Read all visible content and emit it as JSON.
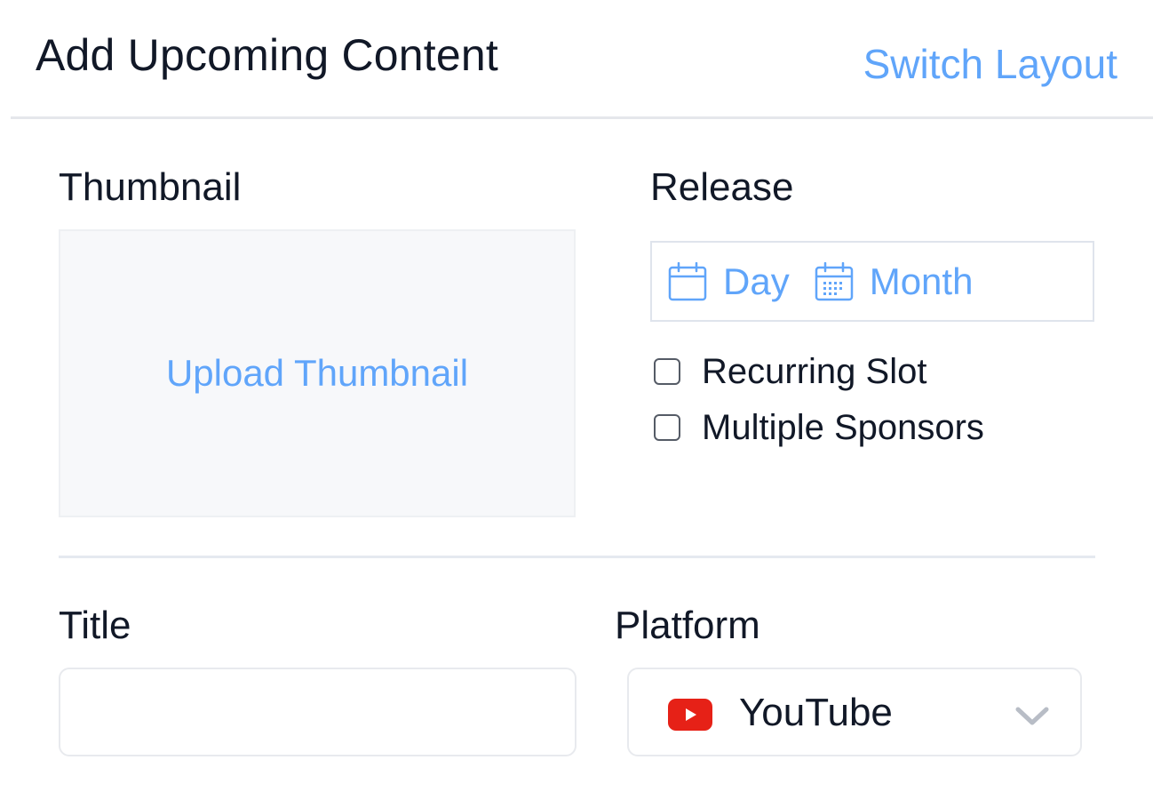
{
  "header": {
    "title": "Add Upcoming Content",
    "switch_layout_label": "Switch Layout"
  },
  "thumbnail": {
    "label": "Thumbnail",
    "upload_label": "Upload Thumbnail"
  },
  "release": {
    "label": "Release",
    "options": [
      {
        "label": "Day",
        "icon": "calendar-icon"
      },
      {
        "label": "Month",
        "icon": "calendar-grid-icon"
      }
    ],
    "checkboxes": [
      {
        "label": "Recurring Slot",
        "checked": false
      },
      {
        "label": "Multiple Sponsors",
        "checked": false
      }
    ]
  },
  "title_field": {
    "label": "Title",
    "value": "",
    "placeholder": ""
  },
  "platform": {
    "label": "Platform",
    "selected": "YouTube",
    "icon": "youtube-icon",
    "dropdown_icon": "chevron-down-icon"
  },
  "colors": {
    "accent": "#60a5fa",
    "text": "#111827",
    "youtube_red": "#e62117",
    "divider": "#e5e7eb"
  }
}
